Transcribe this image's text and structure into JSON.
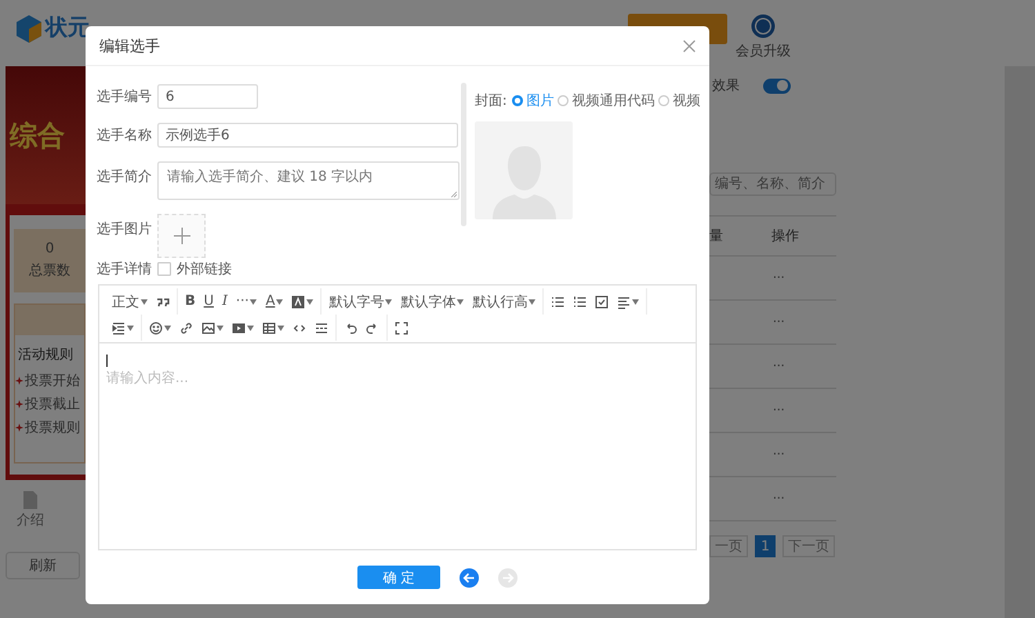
{
  "background": {
    "logo": "状元",
    "member_upgrade": "会员升级",
    "banner_text": "综合",
    "stats": {
      "value": "0",
      "label": "总票数"
    },
    "rules_title": "活动规则",
    "rules": [
      "投票开始",
      "投票截止",
      "投票规则"
    ],
    "intro": "介绍",
    "refresh": "刷新",
    "effect_label": "效果",
    "effect_toggle": {
      "on": true
    },
    "search": {
      "placeholder": "编号、名称、简介"
    },
    "columns": [
      "量",
      "操作"
    ],
    "rows": [
      {
        "action": "···"
      },
      {
        "action": "···"
      },
      {
        "action": "···"
      },
      {
        "action": "···"
      },
      {
        "action": "···"
      },
      {
        "action": "···"
      }
    ],
    "pagination": {
      "prev": "一页",
      "pages": [
        {
          "label": "1",
          "selected": true
        }
      ],
      "next": "下一页"
    }
  },
  "dialog": {
    "title": "编辑选手",
    "fields": [
      {
        "label": "选手编号",
        "value": "6",
        "kind": "short"
      },
      {
        "label": "选手名称",
        "value": "示例选手6",
        "kind": "text"
      },
      {
        "label": "选手简介",
        "placeholder": "请输入选手简介、建议 18 字以内",
        "kind": "textarea"
      },
      {
        "label": "选手图片",
        "kind": "upload"
      }
    ],
    "details": {
      "label": "选手详情",
      "external_link": {
        "label": "外部链接",
        "checked": false
      }
    },
    "cover": {
      "label": "封面:",
      "options": [
        {
          "label": "图片",
          "selected": true
        },
        {
          "label": "视频通用代码",
          "selected": false
        },
        {
          "label": "视频",
          "selected": false
        }
      ]
    },
    "editor": {
      "toolbar": {
        "paragraph": "正文",
        "bold": "B",
        "underline": "U",
        "italic": "I",
        "more": "···",
        "font_color": "A",
        "font_size": "默认字号",
        "font_family": "默认字体",
        "line_height": "默认行高"
      },
      "placeholder": "请输入内容..."
    },
    "confirm": "确 定",
    "prev": {
      "disabled": false
    },
    "next": {
      "disabled": true
    }
  }
}
